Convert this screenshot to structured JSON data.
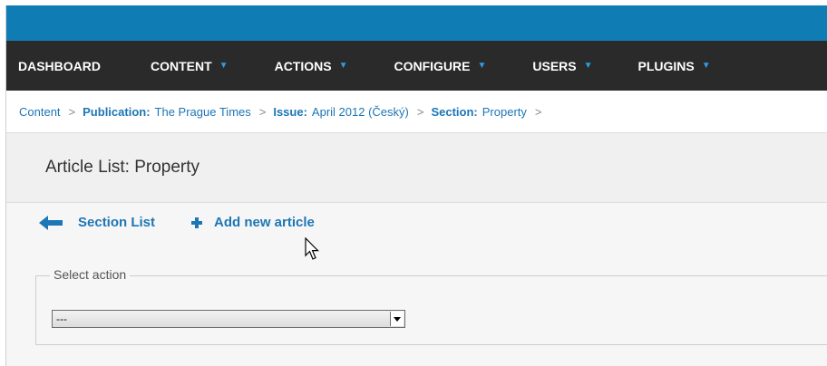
{
  "nav": {
    "items": [
      {
        "label": "DASHBOARD",
        "has_caret": false
      },
      {
        "label": "CONTENT",
        "has_caret": true
      },
      {
        "label": "ACTIONS",
        "has_caret": true
      },
      {
        "label": "CONFIGURE",
        "has_caret": true
      },
      {
        "label": "USERS",
        "has_caret": true
      },
      {
        "label": "PLUGINS",
        "has_caret": true
      }
    ]
  },
  "breadcrumb": {
    "root": "Content",
    "publication_key": "Publication:",
    "publication_val": "The Prague Times",
    "issue_key": "Issue:",
    "issue_val": "April 2012 (Český)",
    "section_key": "Section:",
    "section_val": "Property",
    "separator": ">"
  },
  "page": {
    "title": "Article List: Property"
  },
  "actions": {
    "section_list": "Section List",
    "add_article": "Add new article"
  },
  "select_action": {
    "legend": "Select action",
    "value": "---"
  },
  "colors": {
    "topbar": "#0f7db4",
    "nav_bg": "#2a2a2a",
    "link": "#1d76b5"
  }
}
